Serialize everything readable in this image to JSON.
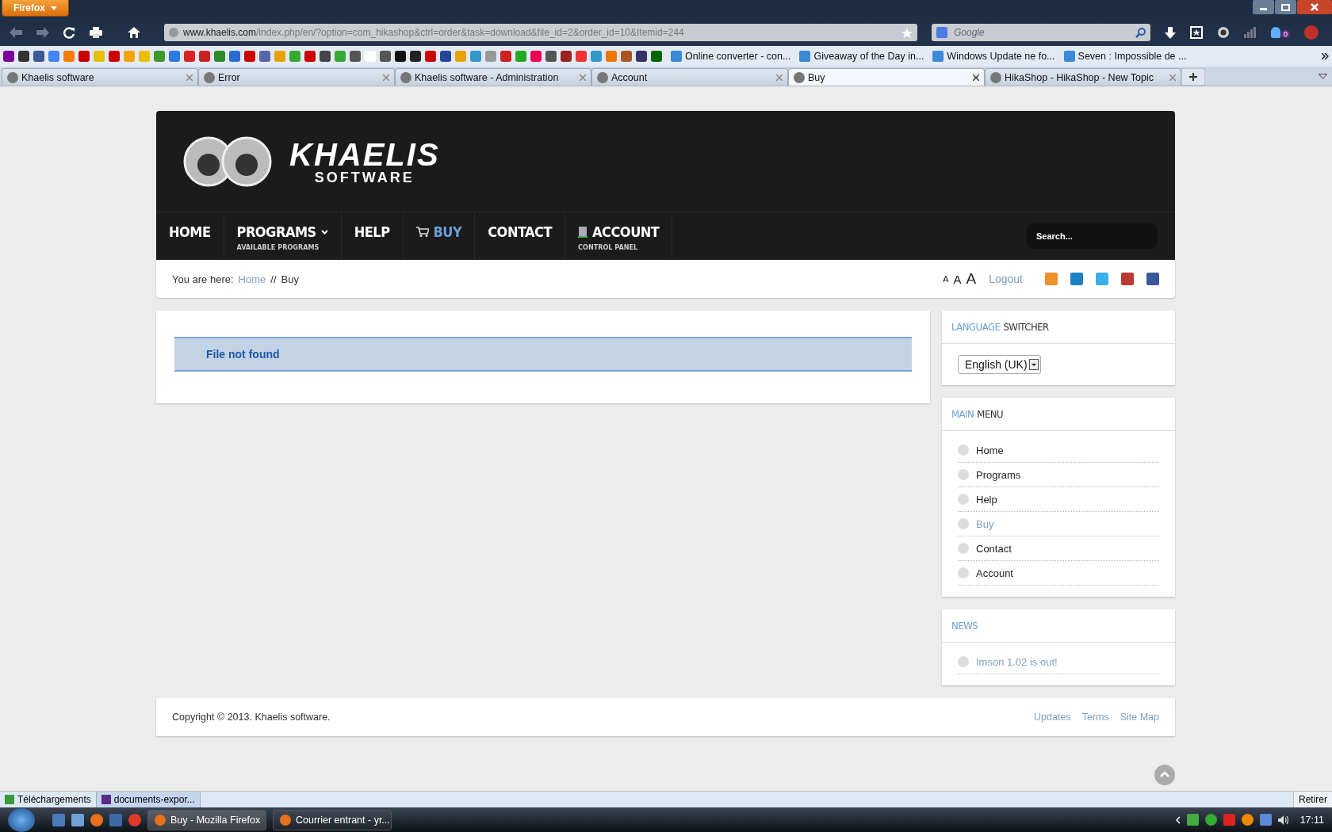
{
  "browser": {
    "menu_button": "Firefox",
    "address": {
      "domain": "www.khaelis.com",
      "path": "/index.php/en/?option=com_hikashop&ctrl=order&task=download&file_id=2&order_id=10&Itemid=244"
    },
    "search_placeholder": "Google",
    "addon_badge": "0"
  },
  "bookmarks": [
    "Online converter - con...",
    "Giveaway of the Day in...",
    "Windows Update ne fo...",
    "Seven : Impossible de ..."
  ],
  "tabs": [
    {
      "title": "Khaelis software",
      "selected": false
    },
    {
      "title": "Error",
      "selected": false
    },
    {
      "title": "Khaelis software - Administration",
      "selected": false
    },
    {
      "title": "Account",
      "selected": false
    },
    {
      "title": "Buy",
      "selected": true
    },
    {
      "title": "HikaShop - HikaShop - New Topic",
      "selected": false
    }
  ],
  "site": {
    "logo": {
      "title": "KHAELIS",
      "subtitle": "SOFTWARE"
    },
    "nav": [
      {
        "label": "HOME",
        "kind": "plain",
        "selected": false
      },
      {
        "label": "PROGRAMS",
        "sub": "AVAILABLE PROGRAMS",
        "kind": "dropdown",
        "selected": false
      },
      {
        "label": "HELP",
        "kind": "plain",
        "selected": false
      },
      {
        "label": "BUY",
        "kind": "cart",
        "selected": true
      },
      {
        "label": "CONTACT",
        "kind": "plain",
        "selected": false
      },
      {
        "label": "ACCOUNT",
        "sub": "CONTROL PANEL",
        "kind": "account",
        "selected": false
      }
    ],
    "search_placeholder": "Search...",
    "breadcrumb": {
      "label": "You are here:",
      "items": [
        {
          "label": "Home",
          "link": true
        },
        {
          "label": "Buy",
          "link": false
        }
      ],
      "separator": "//"
    },
    "font_sizes": [
      "A",
      "A",
      "A"
    ],
    "logout": "Logout",
    "message": "File not found",
    "language": {
      "title": {
        "accent": "LANGUAGE",
        "rest": "SWITCHER"
      },
      "value": "English (UK)"
    },
    "menu": {
      "title": {
        "accent": "MAIN",
        "rest": "MENU"
      },
      "items": [
        {
          "label": "Home",
          "selected": false
        },
        {
          "label": "Programs",
          "selected": false
        },
        {
          "label": "Help",
          "selected": false
        },
        {
          "label": "Buy",
          "selected": true
        },
        {
          "label": "Contact",
          "selected": false
        },
        {
          "label": "Account",
          "selected": false
        }
      ]
    },
    "news": {
      "title": {
        "accent": "NEWS"
      },
      "items": [
        "Imson 1.02 is out!"
      ]
    },
    "footer": {
      "copyright": "Copyright © 2013. Khaelis software.",
      "links": [
        "Updates",
        "Terms",
        "Site Map"
      ]
    }
  },
  "downloads": {
    "items": [
      "Téléchargements",
      "documents-expor..."
    ],
    "clear": "Retirer"
  },
  "taskbar": {
    "windows": [
      {
        "title": "Buy - Mozilla Firefox",
        "selected": true
      },
      {
        "title": "Courrier entrant - yr...",
        "selected": false
      }
    ],
    "clock": "17:11"
  }
}
